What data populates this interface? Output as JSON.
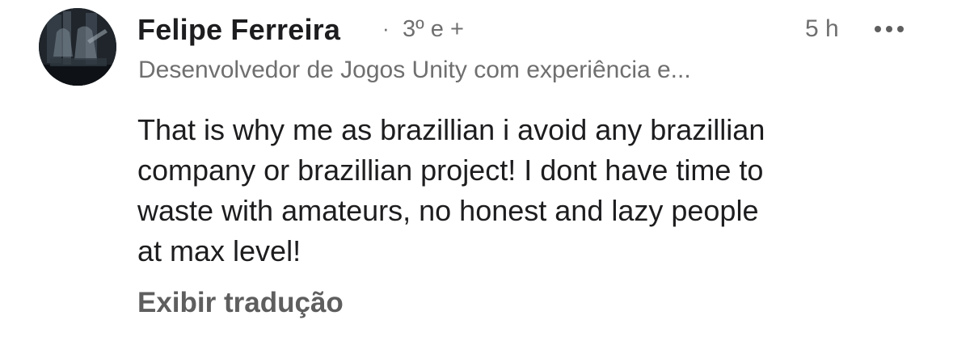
{
  "comment": {
    "author": {
      "name": "Felipe Ferreira",
      "separator": "·",
      "degree": "3º e +",
      "headline": "Desenvolvedor de Jogos Unity com experiência e..."
    },
    "timestamp": "5 h",
    "more_icon": "more-horizontal-icon",
    "body_lines": [
      "That is why me as brazillian i avoid any brazillian",
      "company or brazillian project! I dont have time to",
      "waste with amateurs, no honest and lazy people",
      "at max level!"
    ],
    "translate_label": "Exibir tradução"
  },
  "colors": {
    "name_text": "#1d1d1f",
    "secondary_text": "#6f6f6f",
    "link_text": "#5e5e5e",
    "background": "#ffffff"
  }
}
